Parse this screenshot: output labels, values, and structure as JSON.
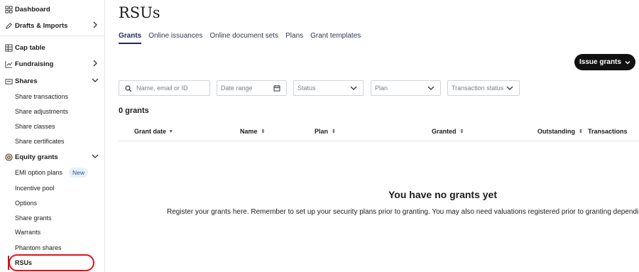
{
  "sidebar": {
    "dashboard": "Dashboard",
    "drafts": "Drafts & Imports",
    "cap_table": "Cap table",
    "fundraising": "Fundraising",
    "shares": "Shares",
    "shares_items": [
      "Share transactions",
      "Share adjustments",
      "Share classes",
      "Share certificates"
    ],
    "equity_grants": "Equity grants",
    "equity_items": [
      "EMI option plans",
      "Incentive pool",
      "Options",
      "Share grants",
      "Warrants",
      "Phantom shares",
      "RSUs"
    ],
    "new_badge": "New",
    "active_item": "RSUs",
    "highlight_color": "#e0131a"
  },
  "page": {
    "title": "RSUs",
    "tabs": [
      "Grants",
      "Online issuances",
      "Online document sets",
      "Plans",
      "Grant templates"
    ],
    "active_tab": "Grants",
    "issue_button": "Issue grants"
  },
  "filters": {
    "search_placeholder": "Name, email or ID",
    "date_range": "Date range",
    "status": "Status",
    "plan": "Plan",
    "transaction_status": "Transaction status"
  },
  "grants": {
    "count": "0 grants",
    "columns": [
      "Grant date",
      "Name",
      "Plan",
      "Granted",
      "Outstanding",
      "Transactions"
    ]
  },
  "empty_state": {
    "title": "You have no grants yet",
    "description": "Register your grants here. Remember to set up your security plans prior to granting. You may also need valuations registered prior to granting dependi"
  },
  "colors": {
    "accent": "#1c2b5a",
    "button_bg": "#111111"
  }
}
